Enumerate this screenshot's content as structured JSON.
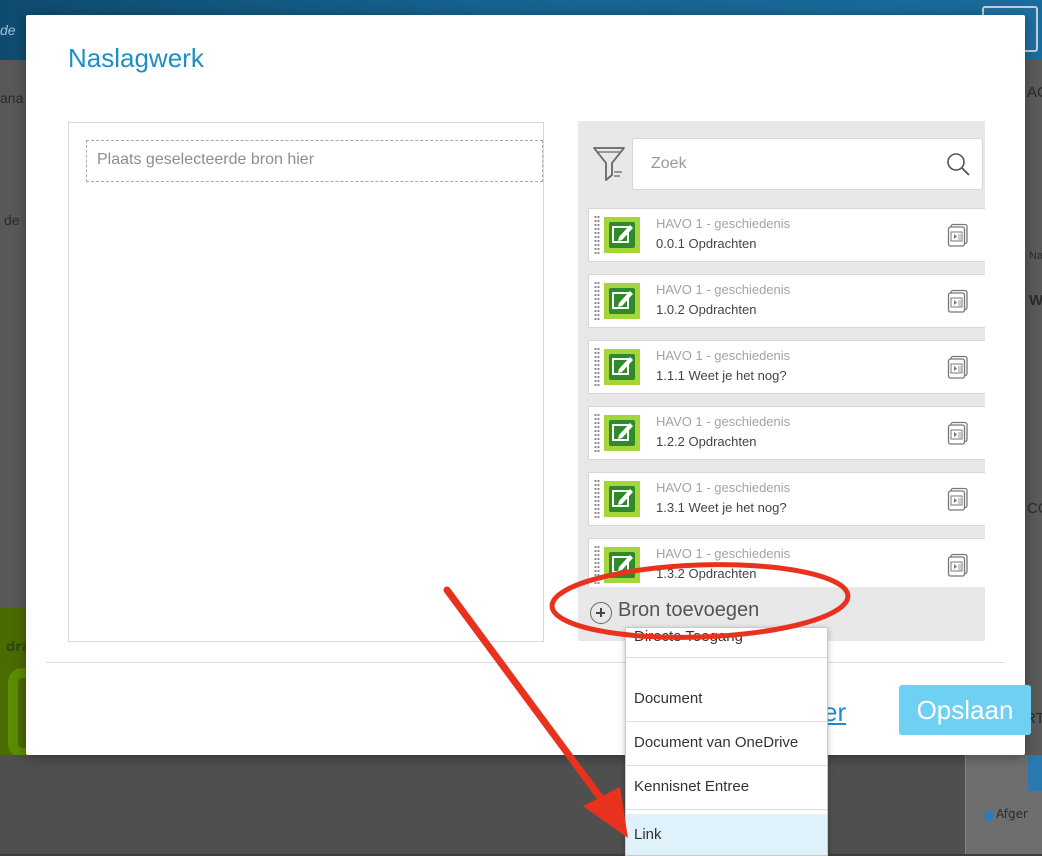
{
  "background": {
    "left_fragments": [
      "de",
      "ana",
      "de",
      "dra"
    ],
    "right_fragments": [
      "AC",
      "Na",
      "W",
      "CO",
      "RT"
    ],
    "right_panel_label": "Afger"
  },
  "modal": {
    "title": "Naslagwerk",
    "drop_zone_label": "Plaats geselecteerde bron hier",
    "search": {
      "placeholder": "Zoek"
    },
    "sources": [
      {
        "course": "HAVO 1 - geschiedenis",
        "title": "0.0.1 Opdrachten"
      },
      {
        "course": "HAVO 1 - geschiedenis",
        "title": "1.0.2 Opdrachten"
      },
      {
        "course": "HAVO 1 - geschiedenis",
        "title": "1.1.1 Weet je het nog?"
      },
      {
        "course": "HAVO 1 - geschiedenis",
        "title": "1.2.2 Opdrachten"
      },
      {
        "course": "HAVO 1 - geschiedenis",
        "title": "1.3.1 Weet je het nog?"
      },
      {
        "course": "HAVO 1 - geschiedenis",
        "title": "1.3.2 Opdrachten"
      }
    ],
    "add_source_label": "Bron toevoegen",
    "cancel_label": "er",
    "save_label": "Opslaan"
  },
  "dropdown": {
    "items": [
      "Directe Toegang",
      "Document",
      "Document van OneDrive",
      "Kennisnet Entree",
      "Link"
    ],
    "active": "Link"
  },
  "colors": {
    "accent": "#1e8fc6",
    "save_button": "#6ed0f3",
    "annotation_red": "#e8321e",
    "source_icon_green": "#a4d53b"
  }
}
